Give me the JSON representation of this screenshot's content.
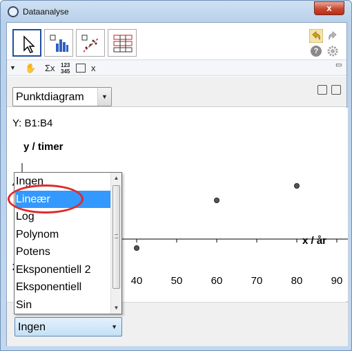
{
  "window": {
    "title": "Dataanalyse",
    "close_glyph": "x"
  },
  "toolbar": {
    "tools": [
      {
        "name": "move-tool",
        "icon": "cursor-arrow-icon"
      },
      {
        "name": "histogram-tool",
        "icon": "bar-histogram-icon"
      },
      {
        "name": "scatter-tool",
        "icon": "scatter-regression-icon"
      },
      {
        "name": "two-variable-tool",
        "icon": "table-compare-icon"
      }
    ],
    "help_glyph": "?",
    "subbar": {
      "sum_label": "Σx",
      "stats_label": "123\n345",
      "x_label": "x"
    }
  },
  "plot_type": {
    "selected": "Punktdiagram"
  },
  "plot": {
    "y_range": "Y:  B1:B4",
    "ylabel": "y / timer",
    "xlabel": "x / år"
  },
  "chart_data": {
    "type": "scatter",
    "xlabel": "x / år",
    "ylabel": "y / timer",
    "x_ticks": [
      "40",
      "50",
      "60",
      "70",
      "80",
      "90"
    ],
    "y_ticks": [
      "2",
      "4"
    ],
    "points": [
      {
        "x": 40,
        "y": 2.45
      },
      {
        "x": 60,
        "y": 3.6
      },
      {
        "x": 80,
        "y": 3.95
      }
    ]
  },
  "regression": {
    "selected": "Ingen",
    "options": [
      "Ingen",
      "Lineær",
      "Log",
      "Polynom",
      "Potens",
      "Eksponentiell 2",
      "Eksponentiell",
      "Sin"
    ],
    "highlighted_index": 1
  },
  "colors": {
    "accent": "#3399ff",
    "annotation": "#e02a2a",
    "frame": "#b9d1ea"
  }
}
